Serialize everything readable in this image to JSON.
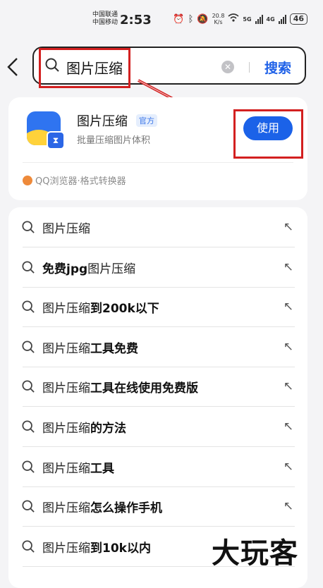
{
  "status_bar": {
    "carrier1": "中国联通",
    "carrier2": "中国移动",
    "time": "2:53",
    "speed_value": "20.8",
    "speed_unit": "K/s",
    "net1": "5G",
    "net2": "4G",
    "battery": "46"
  },
  "search": {
    "query": "图片压缩",
    "clear_icon": "clear-icon",
    "search_label": "搜索"
  },
  "app_card": {
    "name": "图片压缩",
    "badge": "官方",
    "description": "批量压缩图片体积",
    "use_label": "使用",
    "source": "QQ浏览器·格式转换器"
  },
  "suggestions": [
    {
      "base": "图片压缩",
      "rest": "",
      "prefix": ""
    },
    {
      "prefix": "免费jpg",
      "base": "图片压缩",
      "rest": ""
    },
    {
      "prefix": "",
      "base": "图片压缩",
      "rest": "到200k以下"
    },
    {
      "prefix": "",
      "base": "图片压缩",
      "rest": "工具免费"
    },
    {
      "prefix": "",
      "base": "图片压缩",
      "rest": "工具在线使用免费版"
    },
    {
      "prefix": "",
      "base": "图片压缩",
      "rest": "的方法"
    },
    {
      "prefix": "",
      "base": "图片压缩",
      "rest": "工具"
    },
    {
      "prefix": "",
      "base": "图片压缩",
      "rest": "怎么操作手机"
    },
    {
      "prefix": "",
      "base": "图片压缩",
      "rest": "到10k以内"
    }
  ],
  "fill_arrow": "↖",
  "watermark": "大玩客",
  "colors": {
    "accent": "#1b62e8",
    "highlight": "#d32020"
  }
}
